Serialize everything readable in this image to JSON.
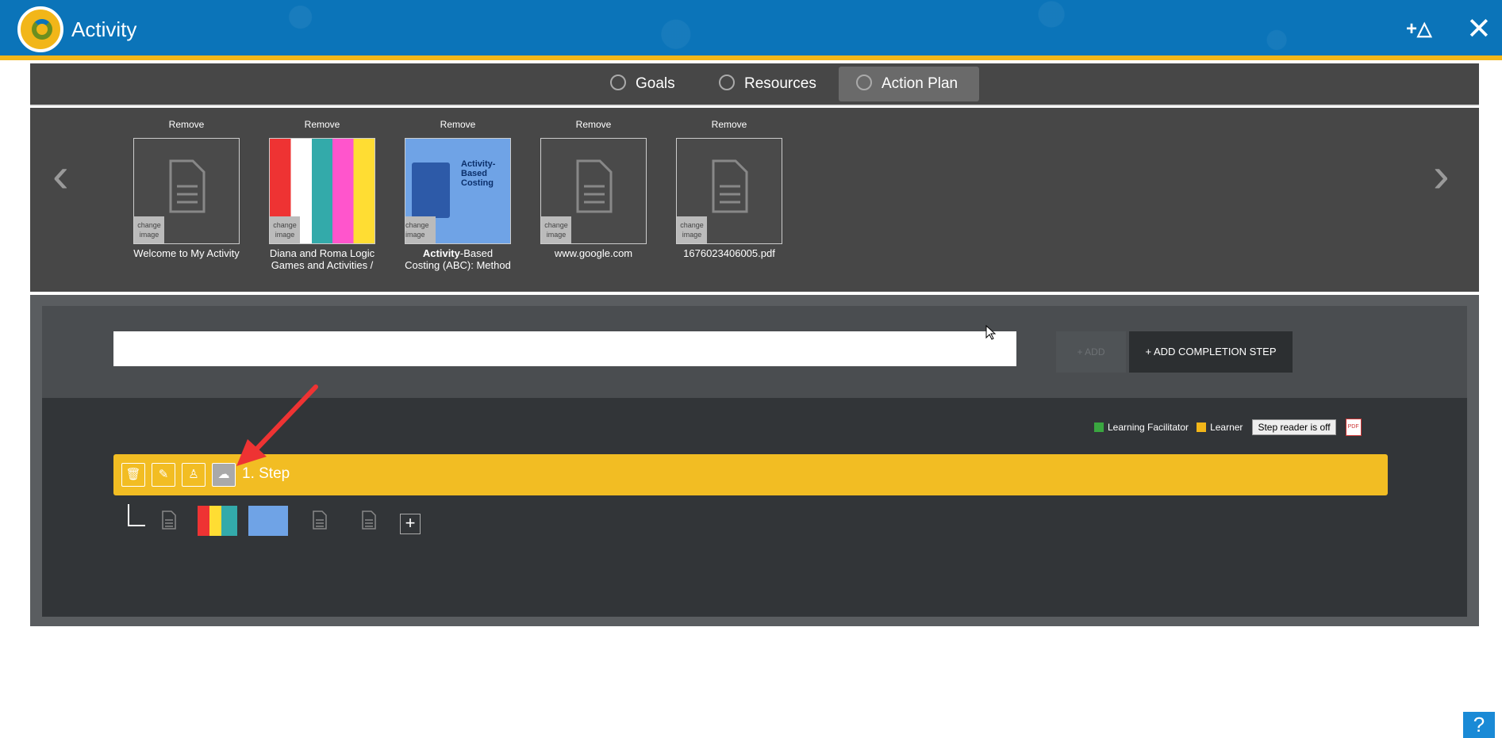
{
  "header": {
    "title": "Activity",
    "add_icon": "plus-triangle-icon",
    "close_icon": "close-icon"
  },
  "tabs": [
    {
      "label": "Goals",
      "active": false
    },
    {
      "label": "Resources",
      "active": false
    },
    {
      "label": "Action Plan",
      "active": true
    }
  ],
  "resources": {
    "items": [
      {
        "remove": "Remove",
        "change": "change image",
        "caption": "Welcome to My Activity",
        "thumb": "document-icon"
      },
      {
        "remove": "Remove",
        "change": "change image",
        "caption": "Diana and Roma Logic Games and Activities /",
        "thumb": "photo"
      },
      {
        "remove": "Remove",
        "change": "change image",
        "caption_bold": "Activity",
        "caption": "-Based Costing (ABC): Method and",
        "thumb": "doc-preview",
        "preview_title": "Activity-Based Costing"
      },
      {
        "remove": "Remove",
        "change": "change image",
        "caption": "www.google.com",
        "thumb": "document-icon"
      },
      {
        "remove": "Remove",
        "change": "change image",
        "caption": "1676023406005.pdf",
        "thumb": "document-icon"
      }
    ],
    "prev": "‹",
    "next": "›"
  },
  "action_plan": {
    "input_value": "",
    "add_label": "+ ADD",
    "completion_label": "+ ADD COMPLETION STEP",
    "legend": {
      "facilitator": "Learning Facilitator",
      "learner": "Learner"
    },
    "reader_label": "Step reader is off",
    "pdf_label": "PDF",
    "step": {
      "label": "1. Step"
    },
    "colors": {
      "step": "#f2bd23",
      "facilitator": "#3aa640",
      "learner": "#f2b619",
      "header": "#0b74b9"
    }
  },
  "help": "?"
}
